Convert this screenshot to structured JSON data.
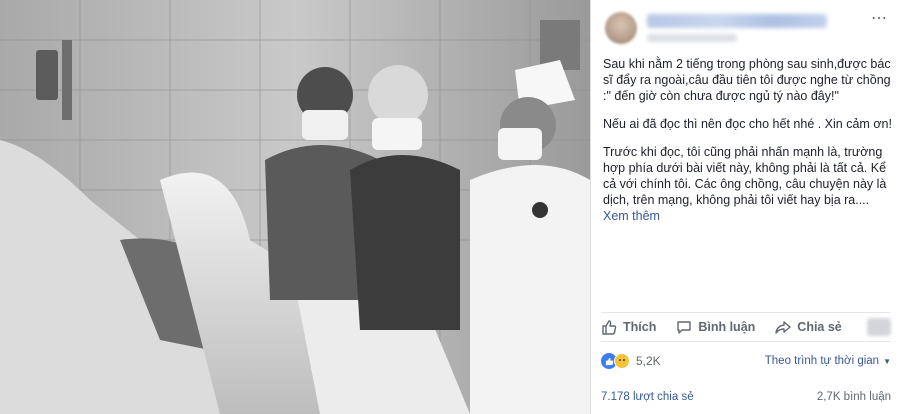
{
  "post": {
    "paragraphs": [
      "Sau khi nằm 2 tiếng trong phòng sau sinh,được bác sĩ đẩy ra ngoài,câu đầu tiên tôi được nghe từ chồng :\" đến giờ còn chưa được ngủ tý nào đây!\"",
      "Nếu ai đã đọc thì nên đọc cho hết nhé . Xin cảm ơn!",
      "Trước khi đọc, tôi cũng phải nhấn mạnh là, trường hợp phía dưới bài viết này, không phải là tất cả. Kể cả với chính tôi. Các ông chồng, câu chuyện này là dịch, trên mạng, không phải tôi viết hay bịa ra...."
    ],
    "see_more": "Xem thêm"
  },
  "actions": {
    "like": "Thích",
    "comment": "Bình luận",
    "share": "Chia sẻ"
  },
  "reactions": {
    "count": "5,2K",
    "icons": [
      "like-icon",
      "sad-icon"
    ],
    "sort_label": "Theo trình tự thời gian"
  },
  "stats": {
    "shares": "7.178 lượt chia sẻ",
    "comments": "2,7K bình luận"
  },
  "colors": {
    "link": "#385898",
    "muted": "#606770",
    "like_blue": "#3b7ded",
    "sad_yellow": "#f5c33b"
  }
}
